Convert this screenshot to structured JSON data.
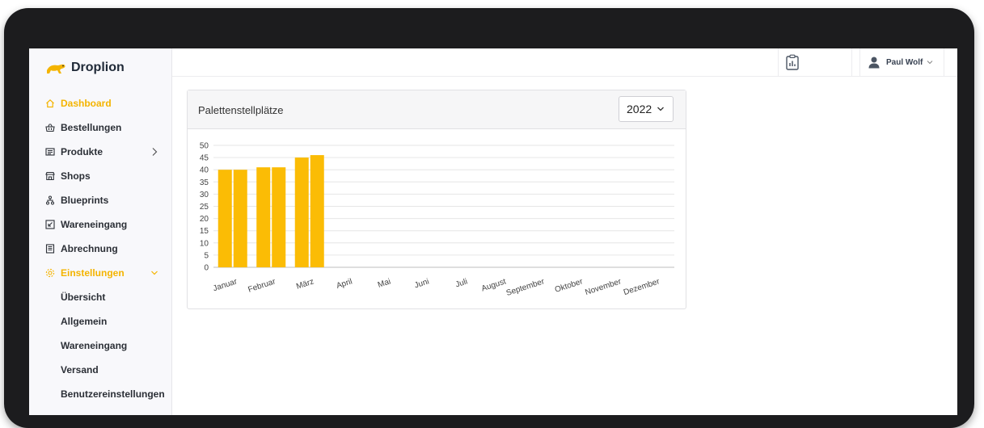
{
  "app": {
    "name": "Droplion",
    "accent": "#f4b400"
  },
  "sidebar": {
    "items": [
      {
        "label": "Dashboard",
        "icon": "home-icon",
        "active": true
      },
      {
        "label": "Bestellungen",
        "icon": "basket-icon"
      },
      {
        "label": "Produkte",
        "icon": "list-icon",
        "has_chevron": true
      },
      {
        "label": "Shops",
        "icon": "store-icon"
      },
      {
        "label": "Blueprints",
        "icon": "hierarchy-icon"
      },
      {
        "label": "Wareneingang",
        "icon": "inbox-icon"
      },
      {
        "label": "Abrechnung",
        "icon": "invoice-icon"
      },
      {
        "label": "Einstellungen",
        "icon": "gear-icon",
        "active": true,
        "expanded": true
      }
    ],
    "sub_items": [
      {
        "label": "Übersicht"
      },
      {
        "label": "Allgemein"
      },
      {
        "label": "Wareneingang"
      },
      {
        "label": "Versand"
      },
      {
        "label": "Benutzereinstellungen"
      }
    ]
  },
  "topbar": {
    "clipboard_icon": "clipboard-chart-icon",
    "user_name": "Paul Wolf",
    "user_icon": "user-icon"
  },
  "card": {
    "title": "Palettenstellplätze",
    "year_selected": "2022"
  },
  "chart_data": {
    "type": "bar",
    "title": "",
    "categories": [
      "Januar",
      "Februar",
      "März",
      "April",
      "Mai",
      "Juni",
      "Juli",
      "August",
      "September",
      "Oktober",
      "November",
      "Dezember"
    ],
    "series": [
      {
        "values": [
          40,
          41,
          45,
          null,
          null,
          null,
          null,
          null,
          null,
          null,
          null,
          null
        ]
      },
      {
        "values": [
          40,
          41,
          46,
          null,
          null,
          null,
          null,
          null,
          null,
          null,
          null,
          null
        ]
      }
    ],
    "ylim": [
      0,
      50
    ],
    "yticks": [
      0,
      5,
      10,
      15,
      20,
      25,
      30,
      35,
      40,
      45,
      50
    ],
    "grid": true,
    "color": "#fbbc05"
  }
}
